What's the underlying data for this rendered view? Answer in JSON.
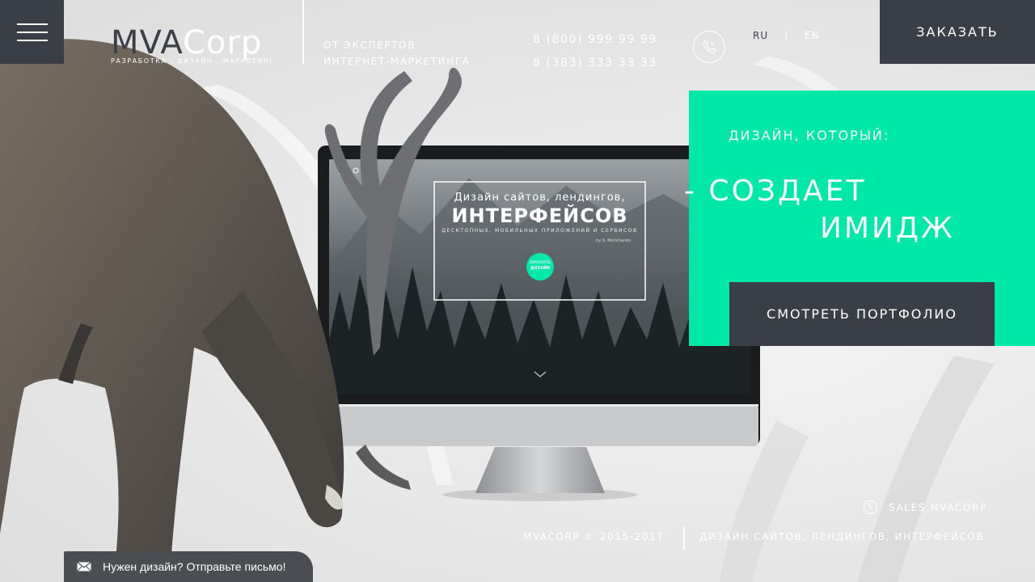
{
  "header": {
    "logo_mva": "MVA",
    "logo_corp": "Corp",
    "logo_sub": "Разработка . дизайн . маркетинг",
    "tagline_line1": "от экспертов",
    "tagline_line2": "интернет-маркетинга",
    "phone1": "8 (800) 999 99 99",
    "phone2": "8 (383) 333 33 33",
    "lang_ru": "RU",
    "lang_sep": "|",
    "lang_en": "EN",
    "order_label": "Заказать"
  },
  "monitor_screen": {
    "title_line1": "Дизайн сайтов, лендингов,",
    "title_line2": "интерфейсов",
    "subtitle": "десктопных, мобильных приложений и сервисов",
    "author": "by S. Morichenko",
    "cta_line1": "заказать",
    "cta_line2": "дизайн"
  },
  "promo": {
    "label": "Дизайн, который:",
    "line1": "- создает",
    "line2": "имидж",
    "portfolio_label": "Смотреть портфолио"
  },
  "footer": {
    "skype": "sales.mvacorp",
    "copyright": "mvacorp © 2015-2017",
    "tagline": "Дизайн сайтов, лендингов, интерфейсов"
  },
  "chat": {
    "label": "Нужен дизайн? Отправьте письмо!"
  },
  "colors": {
    "accent": "#00e8a8",
    "dark": "#3a3f47"
  }
}
